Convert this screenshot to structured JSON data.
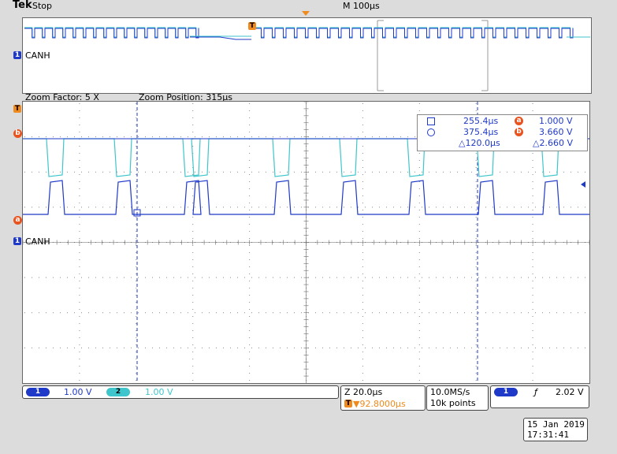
{
  "header": {
    "brand": "Tek",
    "status": "Stop",
    "timebase": "M 100µs"
  },
  "overview": {
    "channel_label": "CANH",
    "channel_number": "1",
    "trigger_marker": "T"
  },
  "zoom": {
    "factor_text": "Zoom Factor: 5 X",
    "position_text": "Zoom Position: 315µs"
  },
  "main": {
    "channel_label": "CANH",
    "channel_number": "1",
    "trigger_marker": "T",
    "cursor_a_label": "a",
    "cursor_b_label": "b"
  },
  "cursor_readout": {
    "t1": "255.4µs",
    "t2": "375.4µs",
    "dt": "△120.0µs",
    "va": "1.000 V",
    "vb": "3.660 V",
    "dv": "△2.660 V"
  },
  "bottom_bar": {
    "ch1_number": "1",
    "ch1_scale": "1.00 V",
    "ch2_number": "2",
    "ch2_scale": "1.00 V",
    "zoom_scale": "Z 20.0µs",
    "trigger_position": "▼92.8000µs",
    "sample_rate": "10.0MS/s",
    "record_length": "10k points",
    "trig_source": "1",
    "trig_slope": "ƒ",
    "trig_level": "2.02 V"
  },
  "datetime": {
    "date": "15 Jan 2019",
    "time": "17:31:41"
  },
  "colors": {
    "ch1": "#1f39c8",
    "ch2": "#3fc6cc",
    "trigger": "#f08a1c",
    "cursor": "#e9531e"
  }
}
